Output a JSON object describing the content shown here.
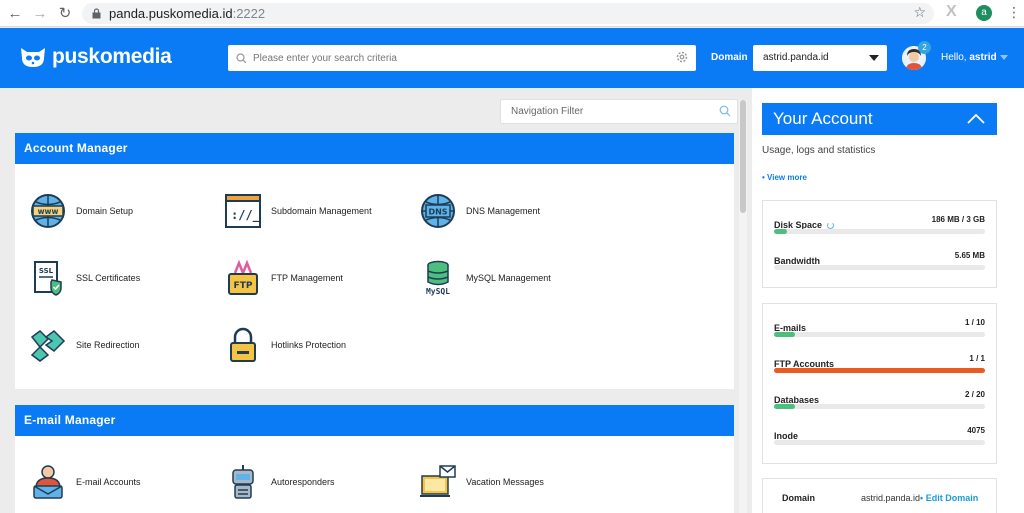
{
  "browser": {
    "url_host": "panda.puskomedia.id",
    "url_port": ":2222",
    "profile_letter": "a"
  },
  "header": {
    "brand": "puskomedia",
    "search_placeholder": "Please enter your search criteria",
    "domain_label": "Domain",
    "domain_value": "astrid.panda.id",
    "notification_count": "2",
    "hello_prefix": "Hello,",
    "hello_user": "astrid"
  },
  "nav_filter": {
    "placeholder": "Navigation Filter"
  },
  "account_manager": {
    "title": "Account Manager",
    "items": [
      {
        "label": "Domain Setup",
        "icon": "www-globe-icon"
      },
      {
        "label": "Subdomain Management",
        "icon": "terminal-icon"
      },
      {
        "label": "DNS Management",
        "icon": "dns-globe-icon"
      },
      {
        "label": "SSL Certificates",
        "icon": "ssl-certificate-icon"
      },
      {
        "label": "FTP Management",
        "icon": "ftp-icon"
      },
      {
        "label": "MySQL Management",
        "icon": "mysql-database-icon"
      },
      {
        "label": "Site Redirection",
        "icon": "redirect-arrows-icon"
      },
      {
        "label": "Hotlinks Protection",
        "icon": "padlock-icon"
      }
    ]
  },
  "email_manager": {
    "title": "E-mail Manager",
    "items": [
      {
        "label": "E-mail Accounts",
        "icon": "email-user-icon"
      },
      {
        "label": "Autoresponders",
        "icon": "robot-icon"
      },
      {
        "label": "Vacation Messages",
        "icon": "vacation-laptop-icon"
      }
    ]
  },
  "your_account": {
    "title": "Your Account",
    "subtitle": "Usage, logs and statistics",
    "view_more": "• View more",
    "usage": [
      {
        "label": "Disk Space",
        "value": "186 MB / 3 GB",
        "fraction": 0.06,
        "color": "#4cbf7f"
      },
      {
        "label": "Bandwidth",
        "value": "5.65 MB",
        "fraction": 0.0,
        "color": "#4cbf7f"
      }
    ],
    "limits": [
      {
        "label": "E-mails",
        "value": "1 / 10",
        "fraction": 0.1,
        "color": "#4cbf7f"
      },
      {
        "label": "FTP Accounts",
        "value": "1 / 1",
        "fraction": 1.0,
        "color": "#ea5b1f"
      },
      {
        "label": "Databases",
        "value": "2 / 20",
        "fraction": 0.1,
        "color": "#4cbf7f"
      },
      {
        "label": "Inode",
        "value": "4075",
        "fraction": 0.0,
        "color": "#4cbf7f"
      }
    ],
    "domain_key": "Domain",
    "domain_value": "astrid.panda.id",
    "edit_domain": "• Edit Domain"
  },
  "colors": {
    "brand_blue": "#0b7bf5",
    "progress_green": "#4cbf7f",
    "progress_orange": "#ea5b1f"
  }
}
